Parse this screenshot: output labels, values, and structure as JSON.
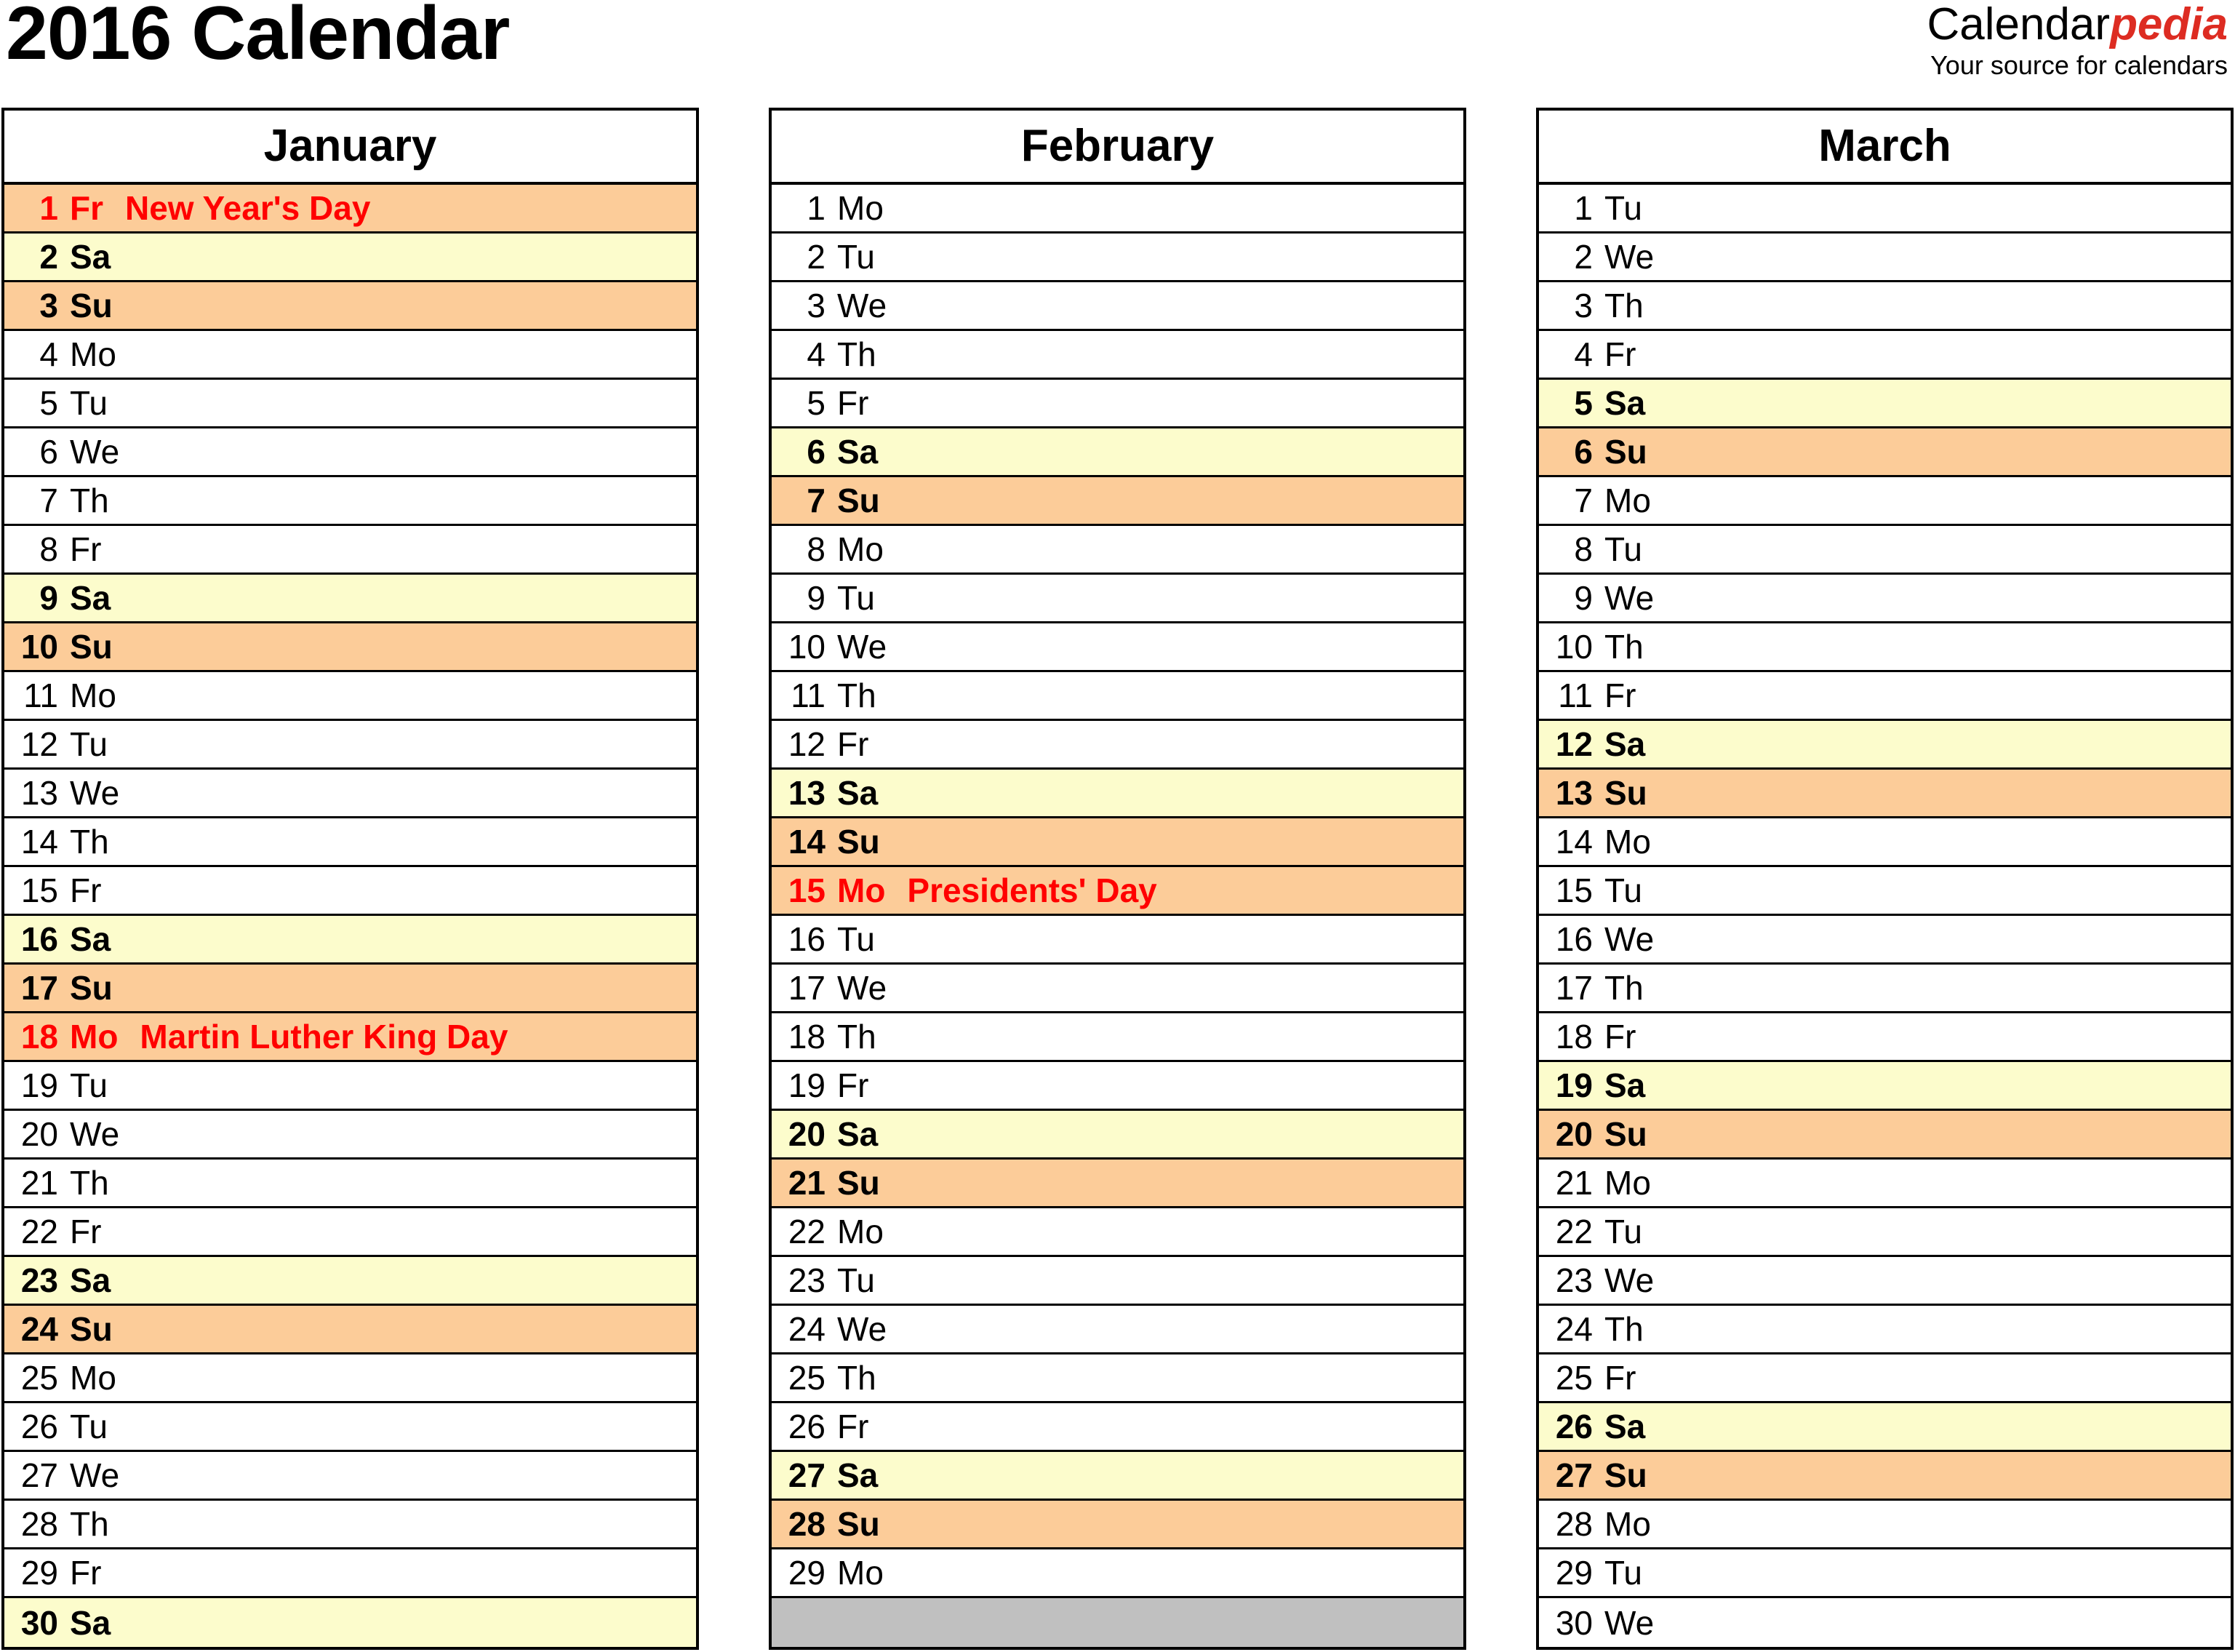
{
  "header": {
    "title": "2016 Calendar",
    "brand_primary": "Calendar",
    "brand_accent": "pedia",
    "brand_tagline": "Your source for calendars"
  },
  "colors": {
    "saturday_bg": "#FCFCCC",
    "sunday_bg": "#FCCC99",
    "holiday_bg": "#FCCC99",
    "holiday_text": "#FF0000",
    "filler_bg": "#C0C0C0",
    "brand_accent": "#DD2C22",
    "border": "#000000"
  },
  "months": [
    {
      "name": "January",
      "days": [
        {
          "num": "1",
          "abbr": "Fr",
          "event": "New Year's Day",
          "kind": "holiday"
        },
        {
          "num": "2",
          "abbr": "Sa",
          "event": "",
          "kind": "saturday"
        },
        {
          "num": "3",
          "abbr": "Su",
          "event": "",
          "kind": "sunday"
        },
        {
          "num": "4",
          "abbr": "Mo",
          "event": "",
          "kind": "weekday"
        },
        {
          "num": "5",
          "abbr": "Tu",
          "event": "",
          "kind": "weekday"
        },
        {
          "num": "6",
          "abbr": "We",
          "event": "",
          "kind": "weekday"
        },
        {
          "num": "7",
          "abbr": "Th",
          "event": "",
          "kind": "weekday"
        },
        {
          "num": "8",
          "abbr": "Fr",
          "event": "",
          "kind": "weekday"
        },
        {
          "num": "9",
          "abbr": "Sa",
          "event": "",
          "kind": "saturday"
        },
        {
          "num": "10",
          "abbr": "Su",
          "event": "",
          "kind": "sunday"
        },
        {
          "num": "11",
          "abbr": "Mo",
          "event": "",
          "kind": "weekday"
        },
        {
          "num": "12",
          "abbr": "Tu",
          "event": "",
          "kind": "weekday"
        },
        {
          "num": "13",
          "abbr": "We",
          "event": "",
          "kind": "weekday"
        },
        {
          "num": "14",
          "abbr": "Th",
          "event": "",
          "kind": "weekday"
        },
        {
          "num": "15",
          "abbr": "Fr",
          "event": "",
          "kind": "weekday"
        },
        {
          "num": "16",
          "abbr": "Sa",
          "event": "",
          "kind": "saturday"
        },
        {
          "num": "17",
          "abbr": "Su",
          "event": "",
          "kind": "sunday"
        },
        {
          "num": "18",
          "abbr": "Mo",
          "event": "Martin Luther King Day",
          "kind": "holiday"
        },
        {
          "num": "19",
          "abbr": "Tu",
          "event": "",
          "kind": "weekday"
        },
        {
          "num": "20",
          "abbr": "We",
          "event": "",
          "kind": "weekday"
        },
        {
          "num": "21",
          "abbr": "Th",
          "event": "",
          "kind": "weekday"
        },
        {
          "num": "22",
          "abbr": "Fr",
          "event": "",
          "kind": "weekday"
        },
        {
          "num": "23",
          "abbr": "Sa",
          "event": "",
          "kind": "saturday"
        },
        {
          "num": "24",
          "abbr": "Su",
          "event": "",
          "kind": "sunday"
        },
        {
          "num": "25",
          "abbr": "Mo",
          "event": "",
          "kind": "weekday"
        },
        {
          "num": "26",
          "abbr": "Tu",
          "event": "",
          "kind": "weekday"
        },
        {
          "num": "27",
          "abbr": "We",
          "event": "",
          "kind": "weekday"
        },
        {
          "num": "28",
          "abbr": "Th",
          "event": "",
          "kind": "weekday"
        },
        {
          "num": "29",
          "abbr": "Fr",
          "event": "",
          "kind": "weekday"
        },
        {
          "num": "30",
          "abbr": "Sa",
          "event": "",
          "kind": "saturday"
        }
      ]
    },
    {
      "name": "February",
      "days": [
        {
          "num": "1",
          "abbr": "Mo",
          "event": "",
          "kind": "weekday"
        },
        {
          "num": "2",
          "abbr": "Tu",
          "event": "",
          "kind": "weekday"
        },
        {
          "num": "3",
          "abbr": "We",
          "event": "",
          "kind": "weekday"
        },
        {
          "num": "4",
          "abbr": "Th",
          "event": "",
          "kind": "weekday"
        },
        {
          "num": "5",
          "abbr": "Fr",
          "event": "",
          "kind": "weekday"
        },
        {
          "num": "6",
          "abbr": "Sa",
          "event": "",
          "kind": "saturday"
        },
        {
          "num": "7",
          "abbr": "Su",
          "event": "",
          "kind": "sunday"
        },
        {
          "num": "8",
          "abbr": "Mo",
          "event": "",
          "kind": "weekday"
        },
        {
          "num": "9",
          "abbr": "Tu",
          "event": "",
          "kind": "weekday"
        },
        {
          "num": "10",
          "abbr": "We",
          "event": "",
          "kind": "weekday"
        },
        {
          "num": "11",
          "abbr": "Th",
          "event": "",
          "kind": "weekday"
        },
        {
          "num": "12",
          "abbr": "Fr",
          "event": "",
          "kind": "weekday"
        },
        {
          "num": "13",
          "abbr": "Sa",
          "event": "",
          "kind": "saturday"
        },
        {
          "num": "14",
          "abbr": "Su",
          "event": "",
          "kind": "sunday"
        },
        {
          "num": "15",
          "abbr": "Mo",
          "event": "Presidents' Day",
          "kind": "holiday"
        },
        {
          "num": "16",
          "abbr": "Tu",
          "event": "",
          "kind": "weekday"
        },
        {
          "num": "17",
          "abbr": "We",
          "event": "",
          "kind": "weekday"
        },
        {
          "num": "18",
          "abbr": "Th",
          "event": "",
          "kind": "weekday"
        },
        {
          "num": "19",
          "abbr": "Fr",
          "event": "",
          "kind": "weekday"
        },
        {
          "num": "20",
          "abbr": "Sa",
          "event": "",
          "kind": "saturday"
        },
        {
          "num": "21",
          "abbr": "Su",
          "event": "",
          "kind": "sunday"
        },
        {
          "num": "22",
          "abbr": "Mo",
          "event": "",
          "kind": "weekday"
        },
        {
          "num": "23",
          "abbr": "Tu",
          "event": "",
          "kind": "weekday"
        },
        {
          "num": "24",
          "abbr": "We",
          "event": "",
          "kind": "weekday"
        },
        {
          "num": "25",
          "abbr": "Th",
          "event": "",
          "kind": "weekday"
        },
        {
          "num": "26",
          "abbr": "Fr",
          "event": "",
          "kind": "weekday"
        },
        {
          "num": "27",
          "abbr": "Sa",
          "event": "",
          "kind": "saturday"
        },
        {
          "num": "28",
          "abbr": "Su",
          "event": "",
          "kind": "sunday"
        },
        {
          "num": "29",
          "abbr": "Mo",
          "event": "",
          "kind": "weekday"
        },
        {
          "num": "",
          "abbr": "",
          "event": "",
          "kind": "filler"
        }
      ]
    },
    {
      "name": "March",
      "days": [
        {
          "num": "1",
          "abbr": "Tu",
          "event": "",
          "kind": "weekday"
        },
        {
          "num": "2",
          "abbr": "We",
          "event": "",
          "kind": "weekday"
        },
        {
          "num": "3",
          "abbr": "Th",
          "event": "",
          "kind": "weekday"
        },
        {
          "num": "4",
          "abbr": "Fr",
          "event": "",
          "kind": "weekday"
        },
        {
          "num": "5",
          "abbr": "Sa",
          "event": "",
          "kind": "saturday"
        },
        {
          "num": "6",
          "abbr": "Su",
          "event": "",
          "kind": "sunday"
        },
        {
          "num": "7",
          "abbr": "Mo",
          "event": "",
          "kind": "weekday"
        },
        {
          "num": "8",
          "abbr": "Tu",
          "event": "",
          "kind": "weekday"
        },
        {
          "num": "9",
          "abbr": "We",
          "event": "",
          "kind": "weekday"
        },
        {
          "num": "10",
          "abbr": "Th",
          "event": "",
          "kind": "weekday"
        },
        {
          "num": "11",
          "abbr": "Fr",
          "event": "",
          "kind": "weekday"
        },
        {
          "num": "12",
          "abbr": "Sa",
          "event": "",
          "kind": "saturday"
        },
        {
          "num": "13",
          "abbr": "Su",
          "event": "",
          "kind": "sunday"
        },
        {
          "num": "14",
          "abbr": "Mo",
          "event": "",
          "kind": "weekday"
        },
        {
          "num": "15",
          "abbr": "Tu",
          "event": "",
          "kind": "weekday"
        },
        {
          "num": "16",
          "abbr": "We",
          "event": "",
          "kind": "weekday"
        },
        {
          "num": "17",
          "abbr": "Th",
          "event": "",
          "kind": "weekday"
        },
        {
          "num": "18",
          "abbr": "Fr",
          "event": "",
          "kind": "weekday"
        },
        {
          "num": "19",
          "abbr": "Sa",
          "event": "",
          "kind": "saturday"
        },
        {
          "num": "20",
          "abbr": "Su",
          "event": "",
          "kind": "sunday"
        },
        {
          "num": "21",
          "abbr": "Mo",
          "event": "",
          "kind": "weekday"
        },
        {
          "num": "22",
          "abbr": "Tu",
          "event": "",
          "kind": "weekday"
        },
        {
          "num": "23",
          "abbr": "We",
          "event": "",
          "kind": "weekday"
        },
        {
          "num": "24",
          "abbr": "Th",
          "event": "",
          "kind": "weekday"
        },
        {
          "num": "25",
          "abbr": "Fr",
          "event": "",
          "kind": "weekday"
        },
        {
          "num": "26",
          "abbr": "Sa",
          "event": "",
          "kind": "saturday"
        },
        {
          "num": "27",
          "abbr": "Su",
          "event": "",
          "kind": "sunday"
        },
        {
          "num": "28",
          "abbr": "Mo",
          "event": "",
          "kind": "weekday"
        },
        {
          "num": "29",
          "abbr": "Tu",
          "event": "",
          "kind": "weekday"
        },
        {
          "num": "30",
          "abbr": "We",
          "event": "",
          "kind": "weekday"
        }
      ]
    }
  ]
}
